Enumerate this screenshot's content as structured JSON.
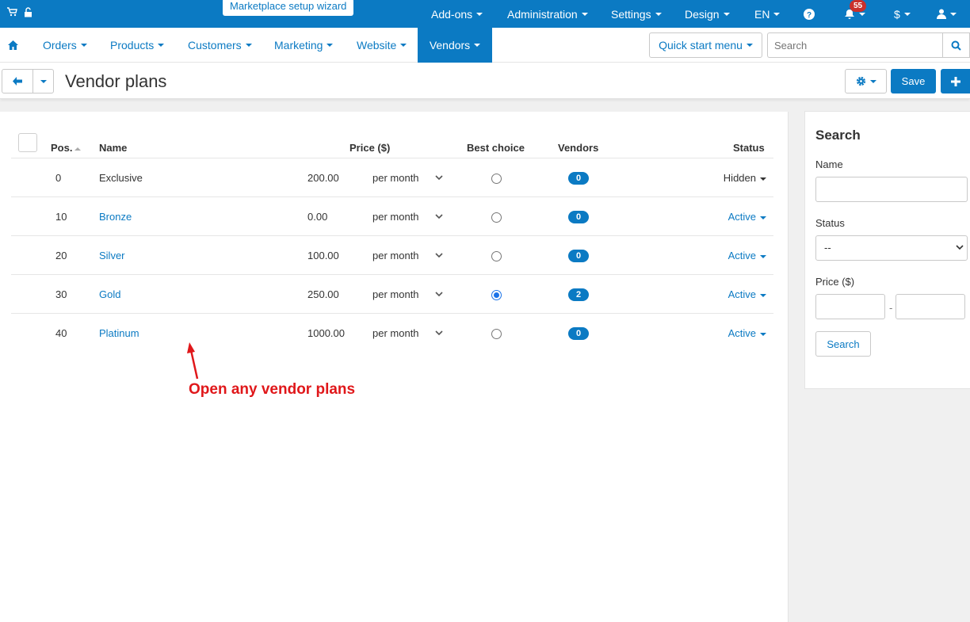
{
  "topbar": {
    "wizard": "Marketplace setup wizard",
    "menus": [
      "Add-ons",
      "Administration",
      "Settings",
      "Design",
      "EN"
    ],
    "notifications_count": "55",
    "currency": "$"
  },
  "nav": {
    "items": [
      "Orders",
      "Products",
      "Customers",
      "Marketing",
      "Website",
      "Vendors"
    ],
    "active": "Vendors",
    "quick_start": "Quick start menu",
    "search_placeholder": "Search"
  },
  "page": {
    "title": "Vendor plans",
    "save_label": "Save"
  },
  "table": {
    "headers": {
      "pos": "Pos.",
      "name": "Name",
      "price": "Price ($)",
      "best_choice": "Best choice",
      "vendors": "Vendors",
      "status": "Status"
    },
    "rows": [
      {
        "pos": "0",
        "name": "Exclusive",
        "price": "200.00",
        "period": "per month",
        "best": false,
        "vendors": "0",
        "status": "Hidden",
        "linked": false
      },
      {
        "pos": "10",
        "name": "Bronze",
        "price": "0.00",
        "period": "per month",
        "best": false,
        "vendors": "0",
        "status": "Active",
        "linked": true
      },
      {
        "pos": "20",
        "name": "Silver",
        "price": "100.00",
        "period": "per month",
        "best": false,
        "vendors": "0",
        "status": "Active",
        "linked": true
      },
      {
        "pos": "30",
        "name": "Gold",
        "price": "250.00",
        "period": "per month",
        "best": true,
        "vendors": "2",
        "status": "Active",
        "linked": true
      },
      {
        "pos": "40",
        "name": "Platinum",
        "price": "1000.00",
        "period": "per month",
        "best": false,
        "vendors": "0",
        "status": "Active",
        "linked": true
      }
    ]
  },
  "annotation": "Open any vendor plans",
  "sidebar": {
    "title": "Search",
    "name_label": "Name",
    "status_label": "Status",
    "status_value": "--",
    "price_label": "Price ($)",
    "price_dash": "-",
    "search_button": "Search"
  },
  "colors": {
    "brand_blue": "#0b7ac3",
    "annotation_red": "#e0171a",
    "badge_red": "#c9302c"
  }
}
